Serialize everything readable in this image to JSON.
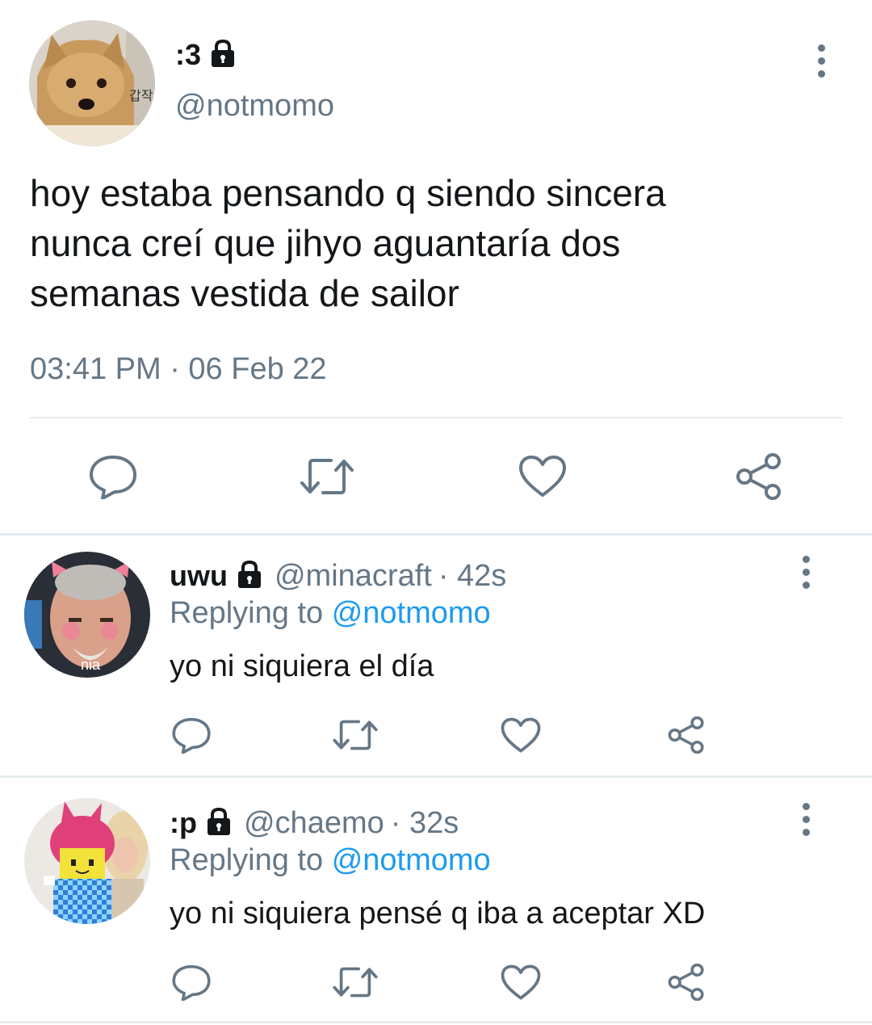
{
  "main_tweet": {
    "display_name": ":3",
    "handle": "@notmomo",
    "avatar_caption": "갑작",
    "text_lines": [
      "hoy estaba pensando q siendo sincera",
      "nunca creí que jihyo aguantaría dos",
      "semanas vestida de sailor"
    ],
    "timestamp": "03:41 PM · 06 Feb 22"
  },
  "replies": [
    {
      "display_name": "uwu",
      "handle": "@minacraft",
      "time": "· 42s",
      "replying_label": "Replying to",
      "replying_to": "@notmomo",
      "avatar_caption": "nia",
      "text": "yo ni siquiera el día"
    },
    {
      "display_name": ":p",
      "handle": "@chaemo",
      "time": "· 32s",
      "replying_label": "Replying to",
      "replying_to": "@notmomo",
      "text": "yo ni siquiera pensé q iba a aceptar XD"
    }
  ],
  "colors": {
    "text": "#14171a",
    "secondary": "#657786",
    "link": "#1d9bf0",
    "divider": "#e6ecf0"
  },
  "icons": [
    "lock-icon",
    "more-vertical-icon",
    "reply-icon",
    "retweet-icon",
    "like-icon",
    "share-icon"
  ]
}
